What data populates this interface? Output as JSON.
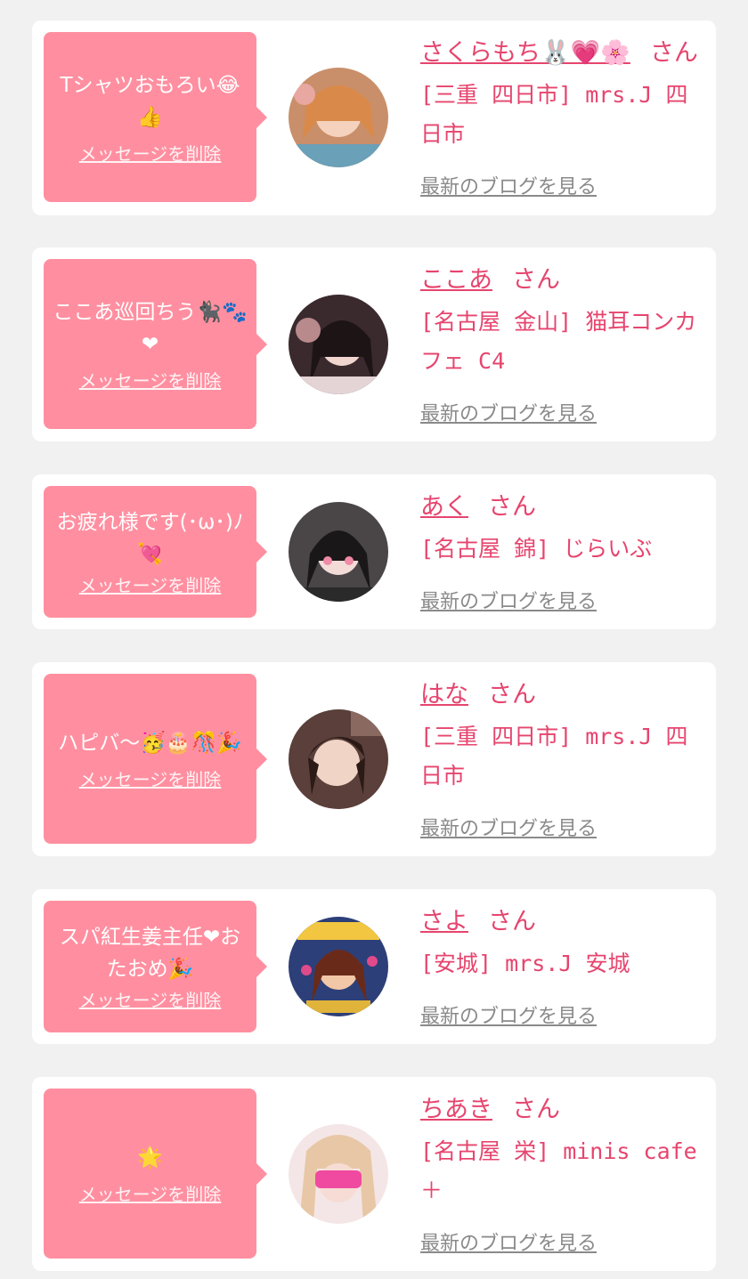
{
  "delete_label": "メッセージを削除",
  "blog_label": "最新のブログを見る",
  "san_label": "さん",
  "colors": {
    "bubble": "#ff8fa0",
    "accent": "#e6456e",
    "page_bg": "#f1f1f2"
  },
  "messages": [
    {
      "message": "Tシャツおもろい😂👍",
      "name": "さくらもち🐰💗🌸",
      "shop": "[三重 四日市] mrs.J 四日市"
    },
    {
      "message": "ここあ巡回ちう🐈‍⬛🐾❤",
      "name": "ここあ",
      "shop": "[名古屋 金山] 猫耳コンカフェ C4"
    },
    {
      "message": "お疲れ様です(･ω･)ﾉ💘",
      "name": "あく",
      "shop": "[名古屋 錦] じらいぶ"
    },
    {
      "message": "ハピバ〜🥳🎂🎊🎉",
      "name": "はな",
      "shop": "[三重 四日市] mrs.J 四日市"
    },
    {
      "message": "スパ紅生姜主任❤おたおめ🎉",
      "name": "さよ",
      "shop": "[安城] mrs.J 安城"
    },
    {
      "message": "🌟",
      "name": "ちあき",
      "shop": "[名古屋 栄] minis cafe ＋"
    }
  ]
}
